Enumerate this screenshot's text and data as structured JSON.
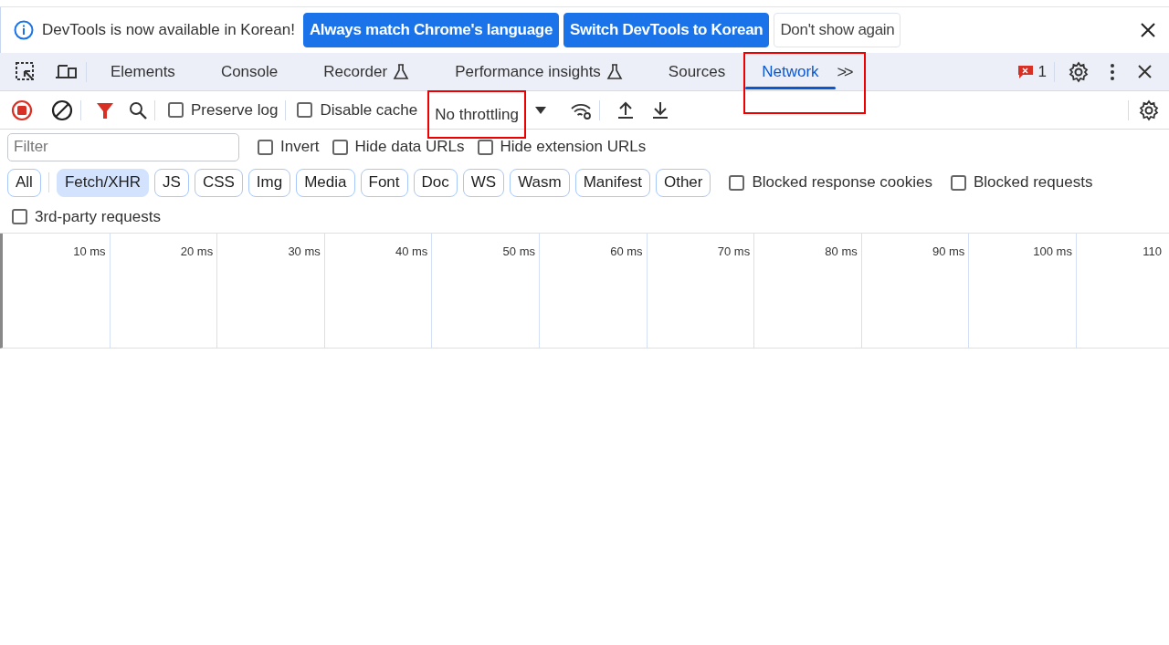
{
  "infobar": {
    "message": "DevTools is now available in Korean!",
    "buttons": [
      {
        "label": "Always match Chrome's language",
        "kind": "primary"
      },
      {
        "label": "Switch DevTools to Korean",
        "kind": "primary"
      },
      {
        "label": "Don't show again",
        "kind": "secondary"
      }
    ]
  },
  "tabs": [
    {
      "label": "Elements",
      "selected": false,
      "experimental": false,
      "highlighted": false
    },
    {
      "label": "Console",
      "selected": false,
      "experimental": false,
      "highlighted": false
    },
    {
      "label": "Recorder",
      "selected": false,
      "experimental": true,
      "highlighted": false
    },
    {
      "label": "Performance insights",
      "selected": false,
      "experimental": true,
      "highlighted": false
    },
    {
      "label": "Sources",
      "selected": false,
      "experimental": false,
      "highlighted": false
    },
    {
      "label": "Network",
      "selected": true,
      "experimental": false,
      "highlighted": true
    }
  ],
  "overflow_button": ">>",
  "issues_count": "1",
  "toolbar": {
    "recording": true,
    "preserve_log": {
      "label": "Preserve log",
      "checked": false
    },
    "disable_cache": {
      "label": "Disable cache",
      "checked": false
    },
    "throttling": {
      "value": "No throttling",
      "highlighted": true
    }
  },
  "filter": {
    "placeholder": "Filter",
    "options": [
      {
        "label": "Invert",
        "checked": false
      },
      {
        "label": "Hide data URLs",
        "checked": false
      },
      {
        "label": "Hide extension URLs",
        "checked": false
      }
    ]
  },
  "type_filters": [
    {
      "label": "All",
      "selected": false
    },
    {
      "label": "Fetch/XHR",
      "selected": true
    },
    {
      "label": "JS",
      "selected": false
    },
    {
      "label": "CSS",
      "selected": false
    },
    {
      "label": "Img",
      "selected": false
    },
    {
      "label": "Media",
      "selected": false
    },
    {
      "label": "Font",
      "selected": false
    },
    {
      "label": "Doc",
      "selected": false
    },
    {
      "label": "WS",
      "selected": false
    },
    {
      "label": "Wasm",
      "selected": false
    },
    {
      "label": "Manifest",
      "selected": false
    },
    {
      "label": "Other",
      "selected": false
    }
  ],
  "extra_options": [
    {
      "label": "Blocked response cookies",
      "checked": false
    },
    {
      "label": "Blocked requests",
      "checked": false
    },
    {
      "label": "3rd-party requests",
      "checked": false
    }
  ],
  "timeline": {
    "ticks": [
      "10 ms",
      "20 ms",
      "30 ms",
      "40 ms",
      "50 ms",
      "60 ms",
      "70 ms",
      "80 ms",
      "90 ms",
      "100 ms",
      "110"
    ]
  }
}
